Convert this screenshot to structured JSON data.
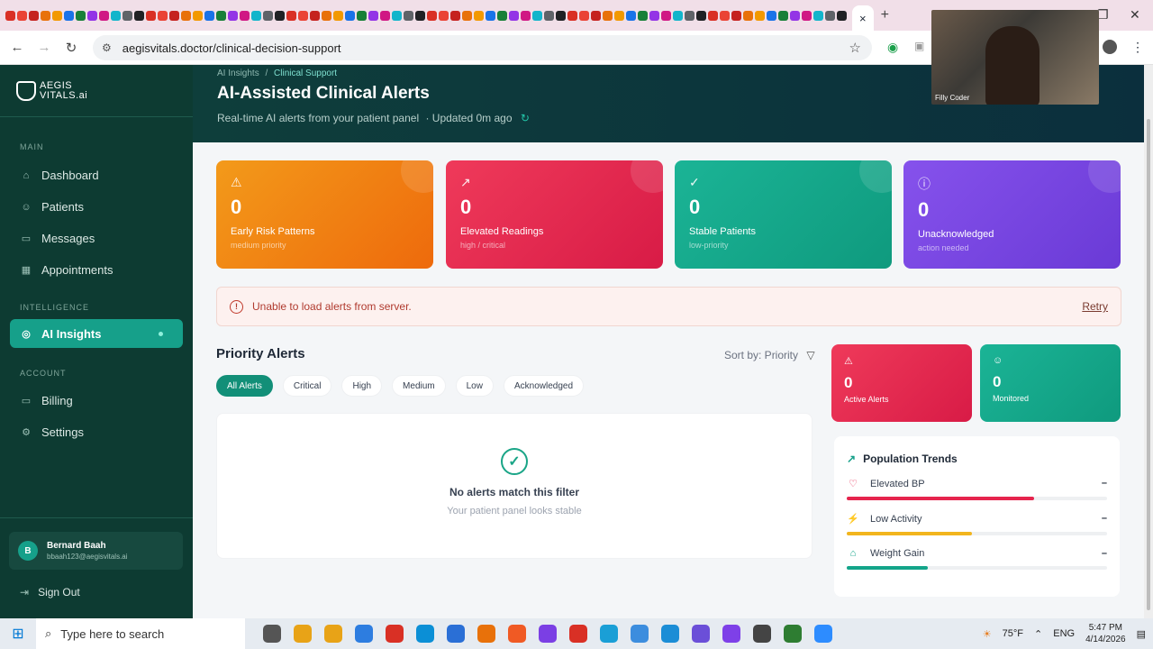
{
  "browser": {
    "active_tab_close": "×",
    "new_tab": "+",
    "url": "aegisvitals.doctor/clinical-decision-support"
  },
  "sidebar": {
    "brand_line1": "AEGIS",
    "brand_line2": "VITALS.ai",
    "section_main": "MAIN",
    "section_intelligence": "INTELLIGENCE",
    "section_account": "ACCOUNT",
    "items": [
      {
        "label": "Dashboard"
      },
      {
        "label": "Patients"
      },
      {
        "label": "Messages"
      },
      {
        "label": "Appointments"
      },
      {
        "label": "AI Insights"
      },
      {
        "label": "Billing"
      },
      {
        "label": "Settings"
      }
    ],
    "user": {
      "initial": "B",
      "name": "Bernard Baah",
      "email": "bbaah123@aegisvitals.ai"
    },
    "sign_out": "Sign Out"
  },
  "header": {
    "breadcrumb_parent": "AI Insights",
    "breadcrumb_sep": "/",
    "breadcrumb_current": "Clinical Support",
    "title": "AI-Assisted Clinical Alerts",
    "subtitle": "Real-time AI alerts from your patient panel",
    "updated": "· Updated 0m ago"
  },
  "kpis": [
    {
      "value": "0",
      "label": "Early Risk Patterns",
      "sub": "medium priority",
      "color": "#f08a12"
    },
    {
      "value": "0",
      "label": "Elevated Readings",
      "sub": "high / critical",
      "color": "#e6244d"
    },
    {
      "value": "0",
      "label": "Stable Patients",
      "sub": "low-priority",
      "color": "#13a58a"
    },
    {
      "value": "0",
      "label": "Unacknowledged",
      "sub": "action needed",
      "color": "#7a46e0"
    }
  ],
  "error": {
    "message": "Unable to load alerts from server.",
    "retry": "Retry"
  },
  "alerts": {
    "heading": "Priority Alerts",
    "sort_label": "Sort by: Priority",
    "filters": [
      "All Alerts",
      "Critical",
      "High",
      "Medium",
      "Low",
      "Acknowledged"
    ],
    "empty_title": "No alerts match this filter",
    "empty_sub": "Your patient panel looks stable"
  },
  "mini_stats": [
    {
      "value": "0",
      "label": "Active Alerts",
      "color": "#e6244d"
    },
    {
      "value": "0",
      "label": "Monitored",
      "color": "#13a58a"
    }
  ],
  "trends": {
    "heading": "Population Trends",
    "rows": [
      {
        "label": "Elevated BP",
        "value": "–",
        "fill": 0.72,
        "color": "#e6244d"
      },
      {
        "label": "Low Activity",
        "value": "–",
        "fill": 0.48,
        "color": "#f2b51d"
      },
      {
        "label": "Weight Gain",
        "value": "–",
        "fill": 0.31,
        "color": "#13a58a"
      }
    ]
  },
  "webcam": {
    "name": "Filly Coder"
  },
  "taskbar": {
    "search_placeholder": "Type here to search",
    "weather": "75°F",
    "language": "ENG",
    "time": "5:47 PM",
    "date": "4/14/2026"
  }
}
